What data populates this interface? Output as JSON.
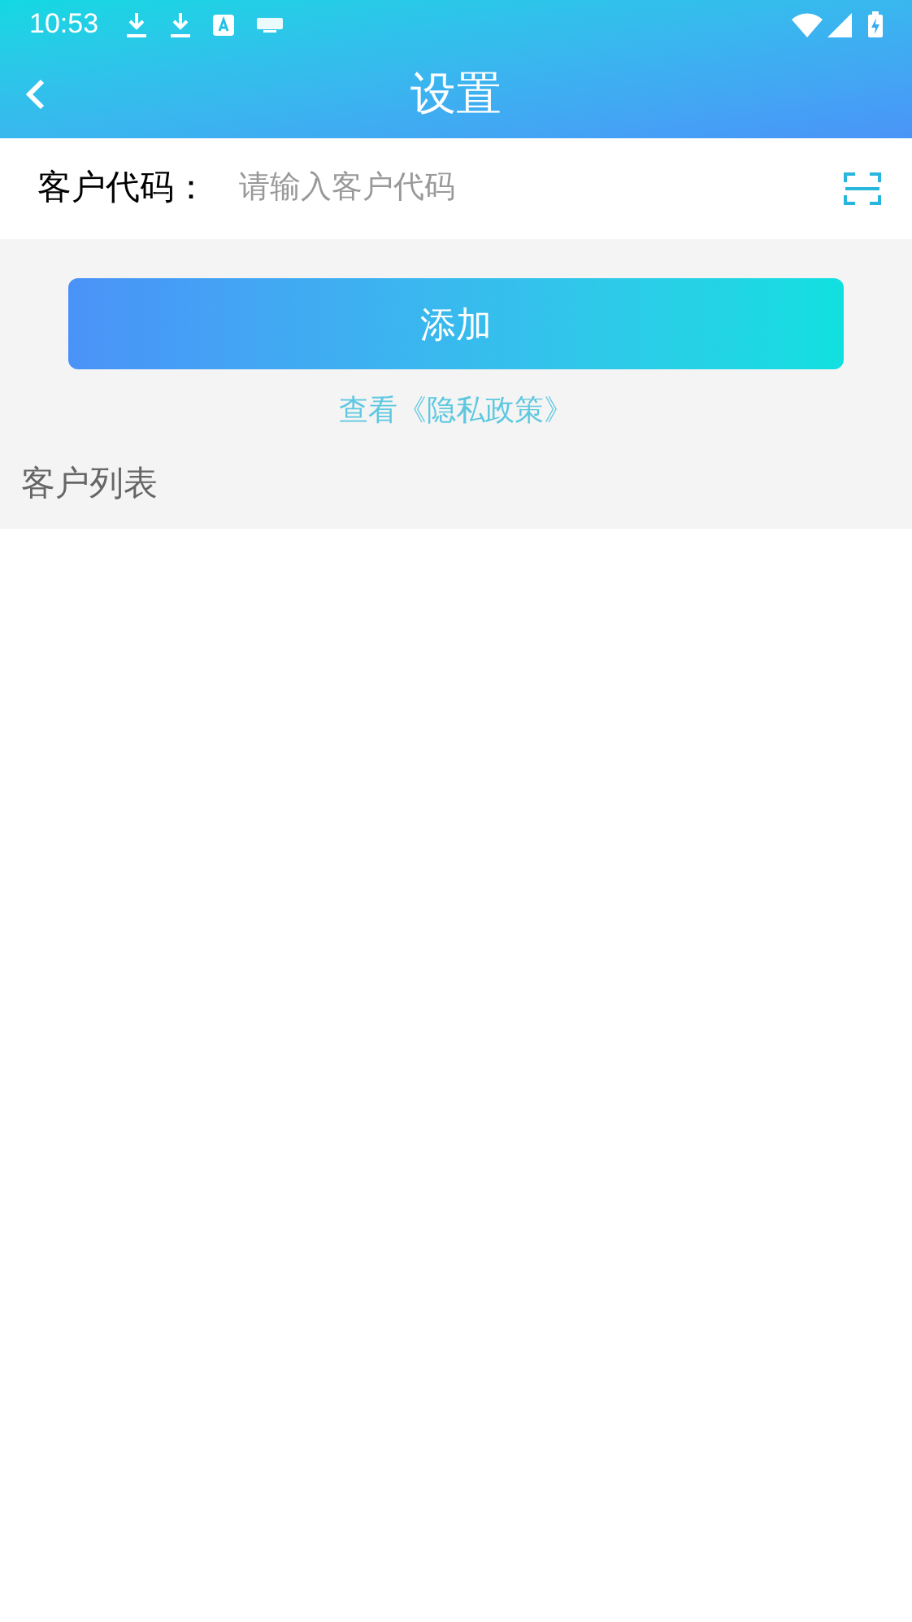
{
  "status_bar": {
    "time": "10:53"
  },
  "header": {
    "title": "设置"
  },
  "customer_code": {
    "label": "客户代码：",
    "placeholder": "请输入客户代码"
  },
  "add_button": {
    "label": "添加"
  },
  "privacy_link": {
    "label": "查看《隐私政策》"
  },
  "customer_list": {
    "title": "客户列表"
  }
}
